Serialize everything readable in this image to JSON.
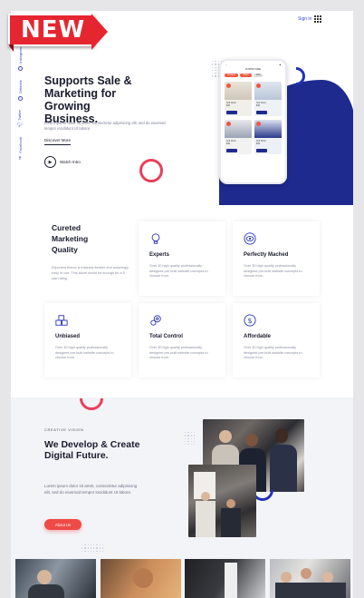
{
  "ribbon": {
    "label": "NEW"
  },
  "header": {
    "signin": "Sign in"
  },
  "social": [
    {
      "label": "Instagram",
      "icon": "instagram-icon"
    },
    {
      "label": "Dribbble",
      "icon": "dribbble-icon"
    },
    {
      "label": "Twitter",
      "icon": "twitter-icon"
    },
    {
      "label": "Facebook",
      "icon": "facebook-icon"
    }
  ],
  "hero": {
    "title": "Supports Sale & Marketing for Growing Business.",
    "description": "Lorem ipsum dolor sit amet, consectetur adipisicing elit, sed do eiusmod tempor incididunt Ut labore.",
    "discover": "Discover More",
    "watch": "Watch Intro"
  },
  "phone": {
    "title": "FURNITURE",
    "pills": [
      "Products",
      "Chairs",
      "Sofa"
    ],
    "cards": [
      {
        "name": "Soft Chair",
        "price": "$39"
      },
      {
        "name": "Soft Chair",
        "price": "$39"
      },
      {
        "name": "Soft Chair",
        "price": "$39"
      },
      {
        "name": "Soft Chair",
        "price": "$39"
      }
    ]
  },
  "curated": {
    "title": "Cureted Marketing Quality",
    "description": "Exponent theme is insanely flexible and amazingly easy to use. This alone would be enough for a 5 star rating."
  },
  "features": [
    {
      "title": "Experts",
      "icon": "lightbulb-icon",
      "description": "Over 30 high quality professionally designed pre-built website concepts to choose from."
    },
    {
      "title": "Perfectly Mached",
      "icon": "eye-icon",
      "description": "Over 30 high quality professionally designed pre-built website concepts to choose from."
    },
    {
      "title": "Unbiased",
      "icon": "boxes-icon",
      "description": "Over 30 high quality professionally designed pre-built website concepts to choose from."
    },
    {
      "title": "Total Control",
      "icon": "gears-icon",
      "description": "Over 30 high quality professionally designed pre-built website concepts to choose from."
    },
    {
      "title": "Affordable",
      "icon": "dollar-icon",
      "description": "Over 30 high quality professionally designed pre-built website concepts to choose from."
    }
  ],
  "creative": {
    "eyebrow": "CREATIVE VISION",
    "title": "We Develop & Create Digital Future.",
    "description": "Lorem ipsum dolor sit amet, consectetur adipisicing elit, sed do eiusmod tempor incididunt Ut labore.",
    "button": "About Us"
  },
  "colors": {
    "accent_blue": "#1f2a8f",
    "accent_red": "#ee4b46"
  }
}
